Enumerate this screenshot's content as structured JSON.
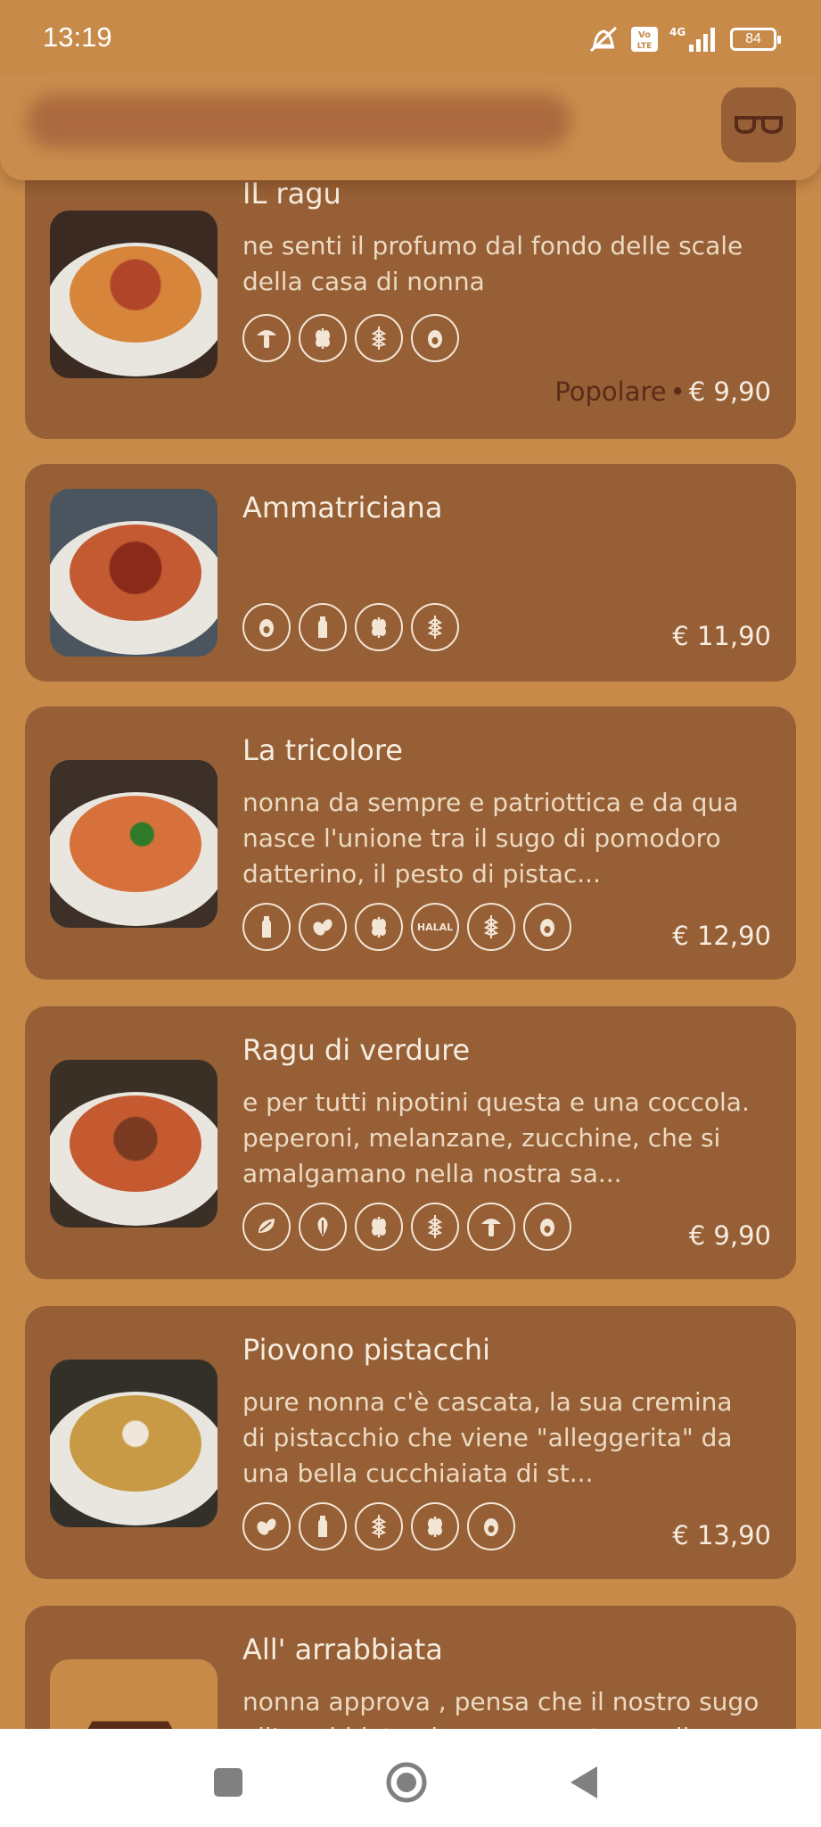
{
  "status": {
    "time": "13:19",
    "battery": "84"
  },
  "header": {
    "reader_icon": "glasses-icon"
  },
  "items": [
    {
      "title": "IL ragu",
      "desc": "ne senti il profumo dal fondo delle scale della casa di nonna",
      "tag": "Popolare",
      "price": "€ 9,90",
      "badges": [
        "mushroom-icon",
        "leaf-icon",
        "wheat-icon",
        "egg-icon"
      ]
    },
    {
      "title": "Ammatriciana",
      "desc": "",
      "tag": "",
      "price": "€ 11,90",
      "badges": [
        "egg-icon",
        "milk-icon",
        "leaf-icon",
        "wheat-icon"
      ]
    },
    {
      "title": "La tricolore",
      "desc": "nonna da sempre e patriottica e da qua nasce l'unione tra il sugo di pomodoro datterino, il pesto di pistac...",
      "tag": "",
      "price": "€ 12,90",
      "badges": [
        "milk-icon",
        "nuts-icon",
        "leaf-icon",
        "halal-icon",
        "wheat-icon",
        "egg-icon"
      ],
      "halal_text": "HALAL"
    },
    {
      "title": "Ragu di verdure",
      "desc": "e per tutti nipotini questa e una coccola. peperoni, melanzane, zucchine, che si amalgamano nella nostra sa...",
      "tag": "",
      "price": "€ 9,90",
      "badges": [
        "vegan-icon",
        "vegetarian-icon",
        "leaf-icon",
        "wheat-icon",
        "mushroom-icon",
        "egg-icon"
      ]
    },
    {
      "title": "Piovono pistacchi",
      "desc": "pure nonna c'è cascata, la sua cremina di pistacchio che viene \"alleggerita\" da una bella cucchiaiata di st...",
      "tag": "",
      "price": "€ 13,90",
      "badges": [
        "nuts-icon",
        "milk-icon",
        "wheat-icon",
        "leaf-icon",
        "egg-icon"
      ]
    },
    {
      "title": "All' arrabbiata",
      "desc": "nonna approva , pensa che il nostro sugo all'arrabbiata viene preparato con il peperoncino",
      "tag": "",
      "price": "",
      "badges": []
    }
  ],
  "nav": {
    "recent": "square-icon",
    "home": "circle-icon",
    "back": "triangle-back-icon"
  },
  "colors": {
    "background": "#c78a49",
    "card": "#965f35",
    "accent_dark": "#5b2b1a"
  }
}
